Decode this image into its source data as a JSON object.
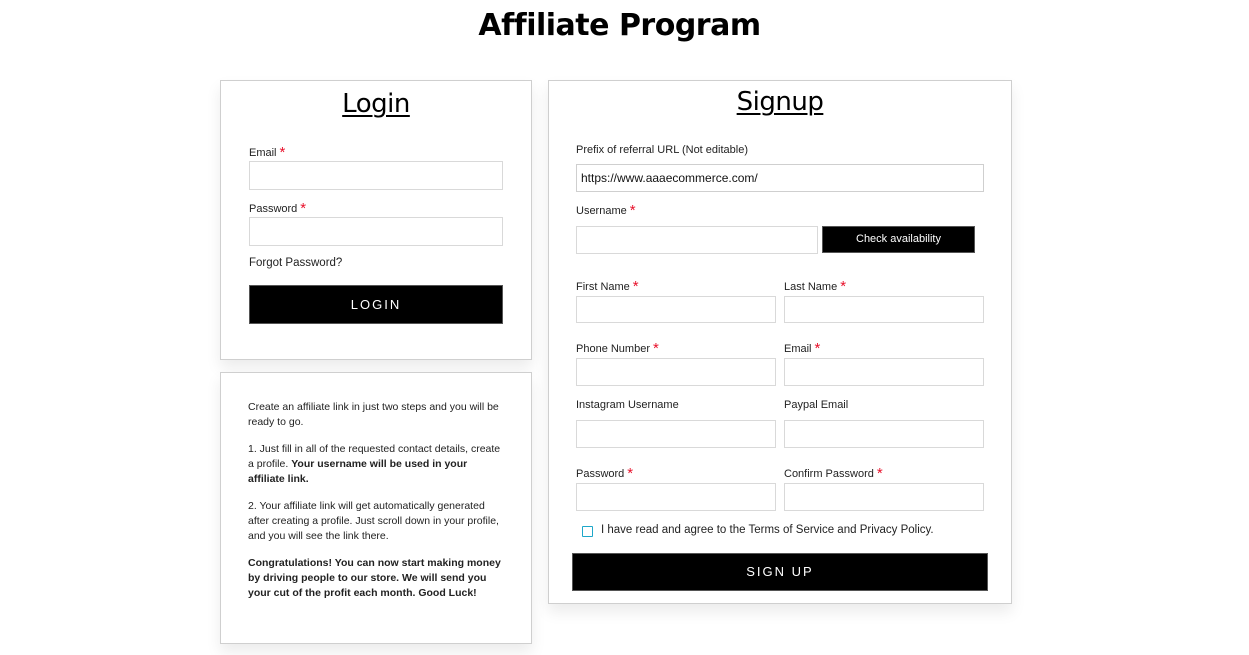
{
  "page": {
    "title": "Affiliate Program"
  },
  "login": {
    "title": "Login",
    "email_label": "Email",
    "email_value": "",
    "password_label": "Password",
    "password_value": "",
    "forgot_password": "Forgot Password?",
    "login_button": "LOGIN",
    "required_mark": "*"
  },
  "info": {
    "intro": "Create an affiliate link in just two steps and you will be ready to go.",
    "step1_plain": "1. Just fill in all of the requested contact details, create a profile. ",
    "step1_bold": "Your username will be used in your affiliate link.",
    "step2": "2. Your affiliate link will get automatically generated after creating a profile. Just scroll down in your profile, and you will see the link there.",
    "congrats": "Congratulations! You can now start making money by driving people to our store. We will send you your cut of the profit each month. Good Luck!"
  },
  "signup": {
    "title": "Signup",
    "required_mark": "*",
    "prefix_label": "Prefix of referral URL (Not editable)",
    "prefix_value": "https://www.aaaecommerce.com/",
    "username_label": "Username",
    "username_value": "",
    "check_availability": "Check availability",
    "first_name_label": "First Name",
    "last_name_label": "Last Name",
    "phone_label": "Phone Number",
    "email_label": "Email",
    "instagram_label": "Instagram Username",
    "paypal_label": "Paypal Email",
    "password_label": "Password",
    "confirm_password_label": "Confirm Password",
    "terms_prefix": "I have read and agree to the ",
    "terms_link": "Terms of Service and Privacy Policy.",
    "terms_checked": false,
    "signup_button": "SIGN UP"
  },
  "colors": {
    "required": "#e8102a",
    "checkbox_border": "#1ea7c9",
    "button_bg": "#000000"
  }
}
